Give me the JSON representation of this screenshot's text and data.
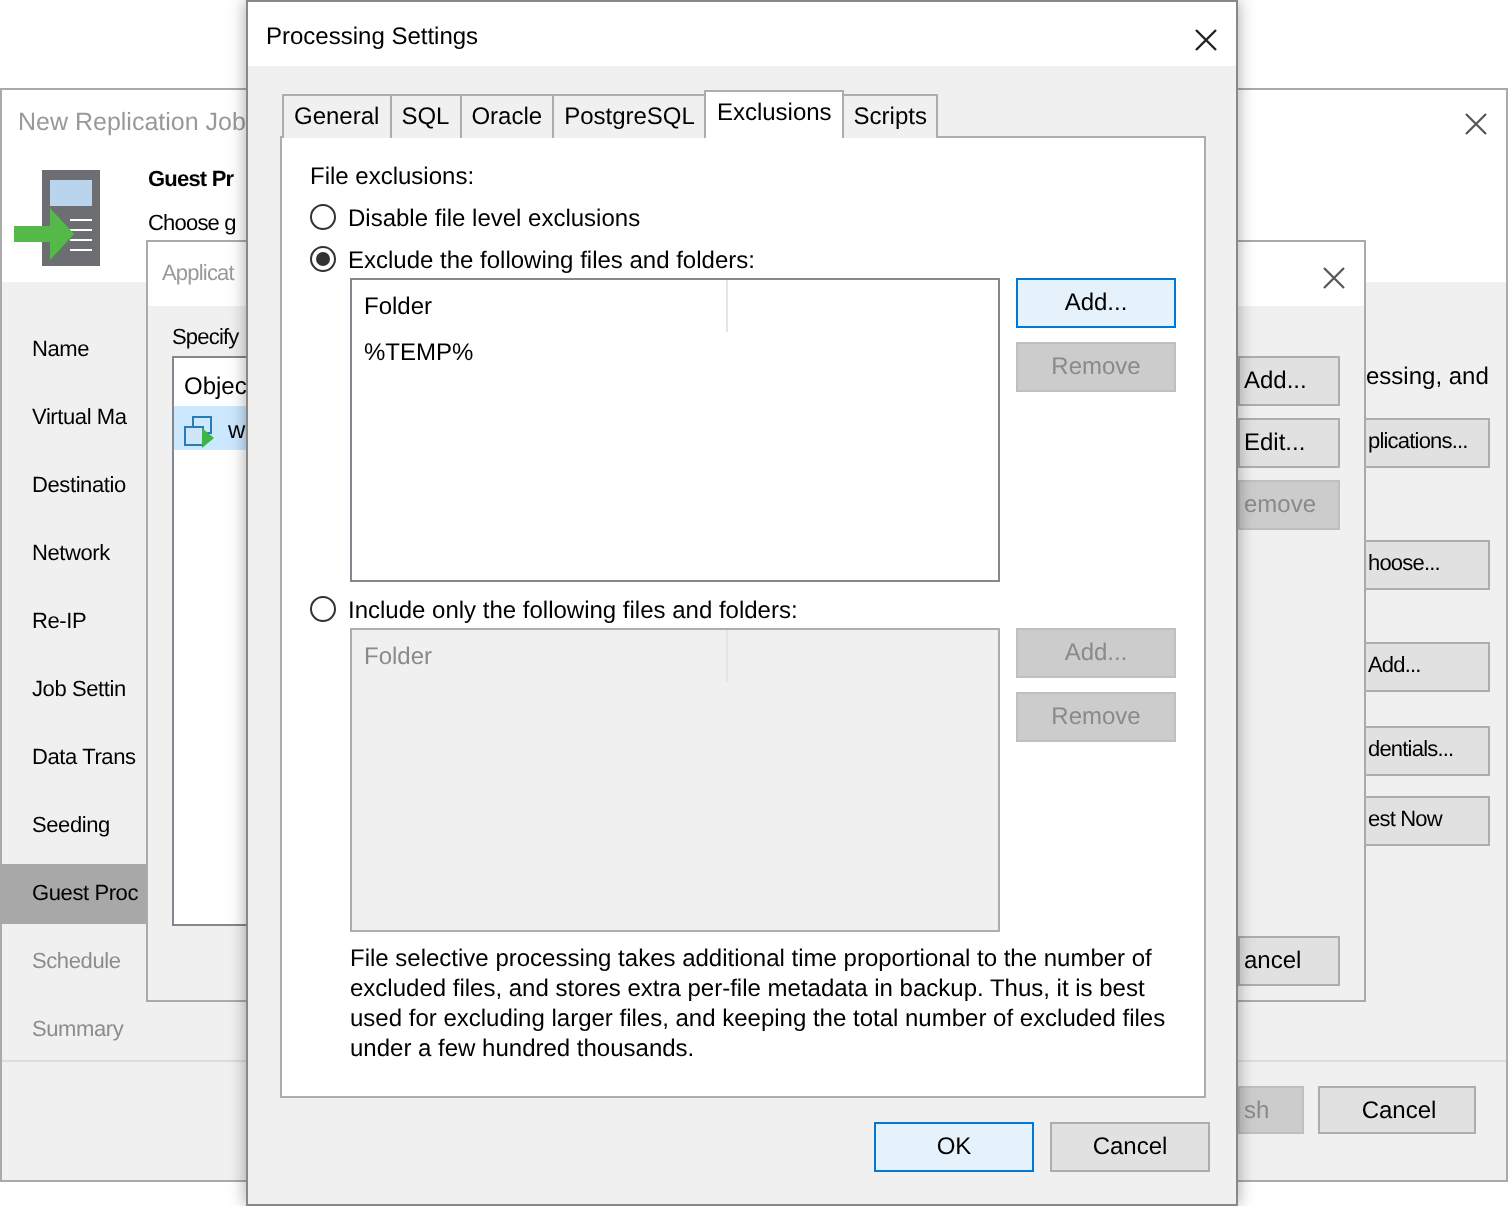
{
  "main_window": {
    "title": "New Replication Job",
    "heading": "Guest Pr",
    "subtitle": "Choose g",
    "steps": [
      {
        "label": "Name",
        "selected": false,
        "disabled": false
      },
      {
        "label": "Virtual Ma",
        "selected": false,
        "disabled": false
      },
      {
        "label": "Destinatio",
        "selected": false,
        "disabled": false
      },
      {
        "label": "Network",
        "selected": false,
        "disabled": false
      },
      {
        "label": "Re-IP",
        "selected": false,
        "disabled": false
      },
      {
        "label": "Job Settin",
        "selected": false,
        "disabled": false
      },
      {
        "label": "Data Trans",
        "selected": false,
        "disabled": false
      },
      {
        "label": "Seeding",
        "selected": false,
        "disabled": false
      },
      {
        "label": "Guest Proc",
        "selected": true,
        "disabled": false
      },
      {
        "label": "Schedule",
        "selected": false,
        "disabled": true
      },
      {
        "label": "Summary",
        "selected": false,
        "disabled": true
      }
    ],
    "description": "essing, and",
    "buttons": [
      {
        "label": "plications...",
        "disabled": false
      },
      {
        "label": "hoose...",
        "disabled": false
      },
      {
        "label": "Add...",
        "disabled": false
      },
      {
        "label": "dentials...",
        "disabled": false
      },
      {
        "label": "est Now",
        "disabled": false
      }
    ],
    "footer_buttons": [
      {
        "label": "sh",
        "disabled": true
      },
      {
        "label": "Cancel",
        "disabled": false
      }
    ]
  },
  "app_window": {
    "title": "Applicat",
    "prompt": "Specify",
    "list_header": "Objec",
    "rows": [
      {
        "label": "w",
        "selected": true
      }
    ],
    "buttons": [
      {
        "label": "Add...",
        "disabled": false
      },
      {
        "label": "Edit...",
        "disabled": false
      },
      {
        "label": "emove",
        "disabled": true
      },
      {
        "label": "ancel",
        "disabled": false
      }
    ]
  },
  "dialog": {
    "title": "Processing Settings",
    "tabs": [
      {
        "label": "General",
        "selected": false
      },
      {
        "label": "SQL",
        "selected": false
      },
      {
        "label": "Oracle",
        "selected": false
      },
      {
        "label": "PostgreSQL",
        "selected": false
      },
      {
        "label": "Exclusions",
        "selected": true
      },
      {
        "label": "Scripts",
        "selected": false
      }
    ],
    "section_label": "File exclusions:",
    "options": [
      {
        "label": "Disable file level exclusions",
        "selected": false
      },
      {
        "label": "Exclude the following files and folders:",
        "selected": true,
        "list": {
          "header": "Folder",
          "disabled": false,
          "rows": [
            "%TEMP%"
          ],
          "buttons": [
            {
              "label": "Add...",
              "disabled": false,
              "focused": true
            },
            {
              "label": "Remove",
              "disabled": true,
              "focused": false
            }
          ]
        }
      },
      {
        "label": "Include only the following files and folders:",
        "selected": false,
        "list": {
          "header": "Folder",
          "disabled": true,
          "buttons": [
            {
              "label": "Add...",
              "disabled": true,
              "focused": false
            },
            {
              "label": "Remove",
              "disabled": true,
              "focused": false
            }
          ]
        }
      }
    ],
    "note": "File selective processing takes additional time proportional to the number of excluded files, and stores extra per-file metadata in backup. Thus, it is best used for excluding larger files, and keeping the total number of excluded files under a few hundred thousands.",
    "footer_buttons": [
      {
        "label": "OK",
        "disabled": false,
        "focused": true
      },
      {
        "label": "Cancel",
        "disabled": false,
        "focused": false
      }
    ]
  }
}
